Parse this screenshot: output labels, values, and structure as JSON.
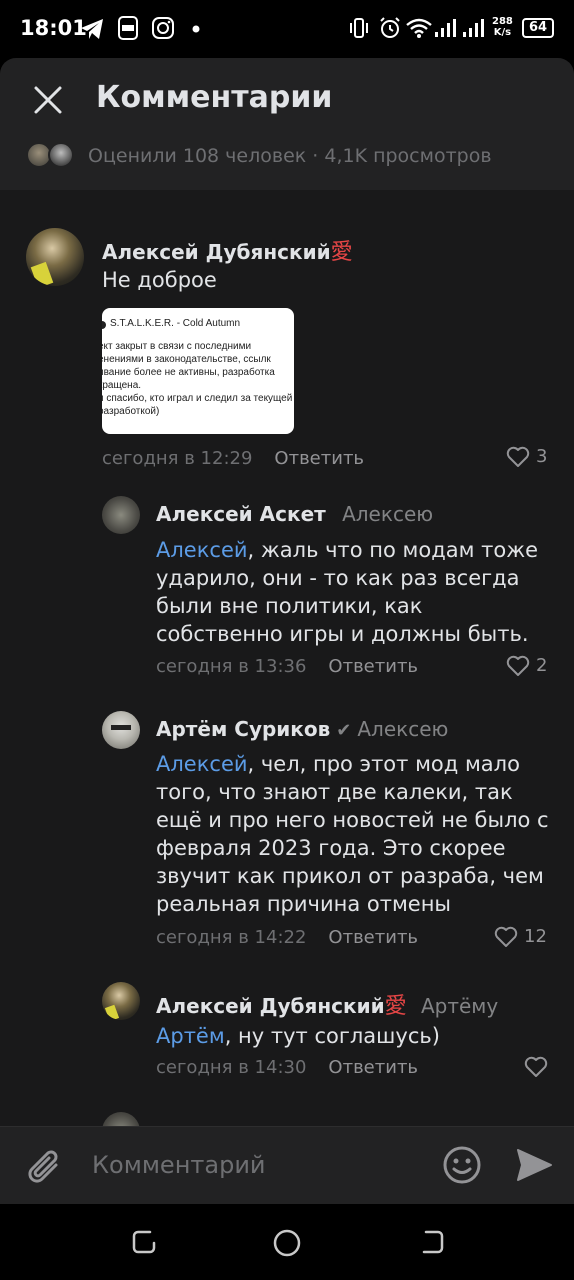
{
  "status_bar": {
    "time": "18:01",
    "net_speed_top": "288",
    "net_speed_bottom": "K/s",
    "battery": "64",
    "icons": [
      "telegram-icon",
      "live-icon",
      "instagram-icon",
      "dot-icon",
      "vibrate-icon",
      "alarm-icon",
      "wifi-icon",
      "signal-icon",
      "signal-icon",
      "battery-icon"
    ]
  },
  "header": {
    "title": "Комментарии",
    "stats": "Оценили 108 человек · 4,1K просмотров"
  },
  "comments": [
    {
      "author": "Алексей Дубянский",
      "badge": "愛",
      "reply_to": "",
      "mention": "",
      "text": "Не доброе",
      "attachment": {
        "title": "S.T.A.L.K.E.R. - Cold Autumn",
        "body": "ект закрыт в связи с последними енениями в законодательстве, ссылк ивание более не активны, разработка кращена.\nи спасибо, кто играл и следил за текущей разработкой)"
      },
      "time": "сегодня в 12:29",
      "reply_label": "Ответить",
      "likes": "3"
    },
    {
      "author": "Алексей Аскет",
      "reply_to": "Алексею",
      "mention": "Алексей",
      "text": ", жаль что по модам тоже ударило, они - то как раз всегда были вне политики, как собственно игры и должны быть.",
      "time": "сегодня в 13:36",
      "reply_label": "Ответить",
      "likes": "2"
    },
    {
      "author": "Артём Суриков",
      "reply_to": "Алексею",
      "mention": "Алексей",
      "text": ", чел, про этот мод мало того, что знают две калеки, так ещё и про него новостей не было с февраля 2023 года. Это скорее звучит как прикол от разраба, чем реальная причина отмены",
      "time": "сегодня в 14:22",
      "reply_label": "Ответить",
      "likes": "12"
    },
    {
      "author": "Алексей Дубянский",
      "badge": "愛",
      "reply_to": "Артёму",
      "mention": "Артём",
      "text": ", ну тут соглашусь)",
      "time": "сегодня в 14:30",
      "reply_label": "Ответить",
      "likes": ""
    }
  ],
  "composer": {
    "placeholder": "Комментарий"
  },
  "colors": {
    "accent": "#5c9ce6",
    "background": "#19191a",
    "header": "#222223",
    "badge": "#e64646"
  }
}
